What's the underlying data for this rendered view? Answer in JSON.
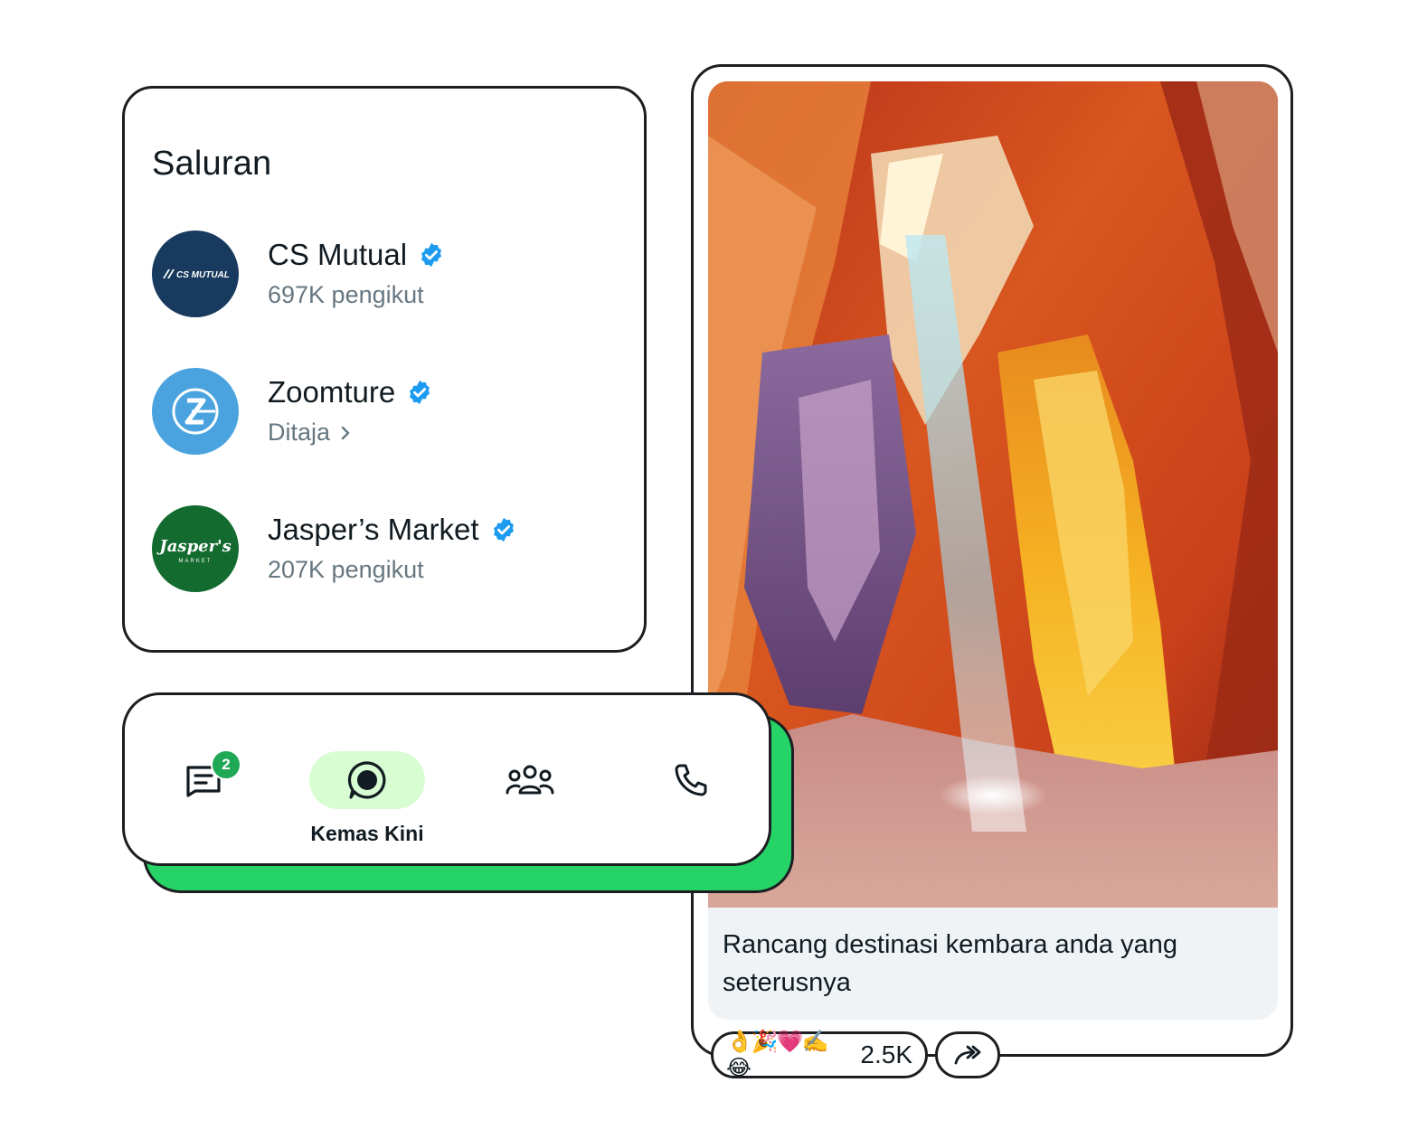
{
  "channels": {
    "title": "Saluran",
    "items": [
      {
        "name": "CS Mutual",
        "subtitle": "697K pengikut",
        "avatar_text": "CS MUTUAL",
        "avatar_color": "#173a5e"
      },
      {
        "name": "Zoomture",
        "subtitle": "Ditaja",
        "avatar_text": "Z",
        "avatar_color": "#4aa3df"
      },
      {
        "name": "Jasper’s Market",
        "subtitle": "207K pengikut",
        "avatar_text": "Jasper's",
        "avatar_text2": "MARKET",
        "avatar_color": "#136b2f"
      }
    ]
  },
  "nav": {
    "chats_badge": "2",
    "active_label": "Kemas Kini",
    "active_color": "#d9fdd3",
    "shadow_color": "#25d366"
  },
  "post": {
    "caption": "Rancang destinasi kembara anda yang seterusnya",
    "reactions": "👌🎉💗✍️😂",
    "reaction_count": "2.5K"
  },
  "colors": {
    "verified": "#1d9bf0",
    "subtitle": "#667781"
  }
}
